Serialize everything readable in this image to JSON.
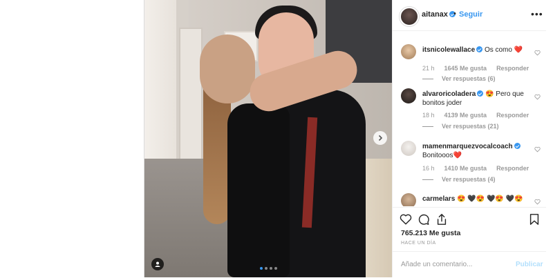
{
  "header": {
    "username": "aitanax",
    "separator": "•",
    "follow_label": "Seguir",
    "more_label": "•••"
  },
  "comments": [
    {
      "username": "itsnicolewallace",
      "verified": true,
      "text": "Os como ❤️",
      "time": "21 h",
      "likes": "1645 Me gusta",
      "reply_label": "Responder",
      "view_replies": "Ver respuestas (6)"
    },
    {
      "username": "alvaroricoladera",
      "verified": true,
      "text": "😍 Pero que bonitos joder",
      "time": "18 h",
      "likes": "4139 Me gusta",
      "reply_label": "Responder",
      "view_replies": "Ver respuestas (21)"
    },
    {
      "username": "mamenmarquezvocalcoach",
      "verified": true,
      "text": "Bonitooos❤️",
      "time": "16 h",
      "likes": "1410 Me gusta",
      "reply_label": "Responder",
      "view_replies": "Ver respuestas (4)"
    },
    {
      "username": "carmelars",
      "verified": false,
      "text": "😍 🖤😍 🖤😍 🖤😍",
      "time": "",
      "likes": "",
      "reply_label": "",
      "view_replies": ""
    }
  ],
  "post": {
    "likes": "765.213 Me gusta",
    "time_ago": "Hace un día",
    "carousel_current": 1,
    "carousel_total": 4
  },
  "compose": {
    "placeholder": "Añade un comentario...",
    "publish_label": "Publicar"
  },
  "colors": {
    "accent": "#3897f0",
    "text": "#262626",
    "muted": "#999999",
    "heart": "#ed4956"
  }
}
